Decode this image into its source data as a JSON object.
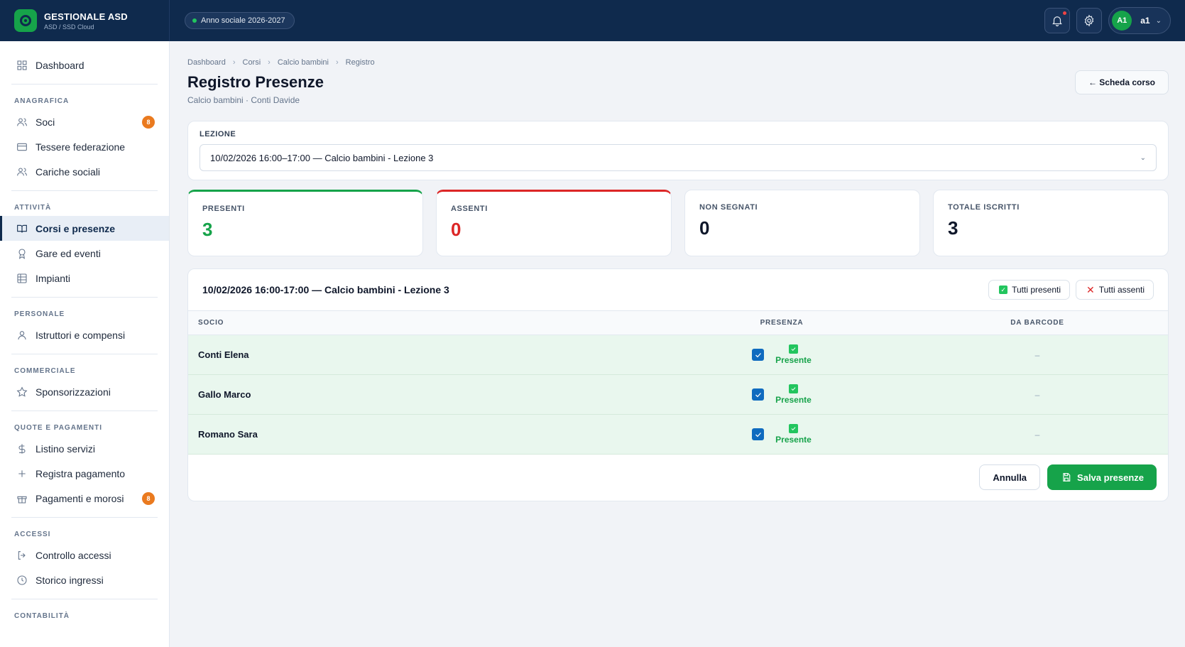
{
  "app": {
    "name": "GESTIONALE ASD",
    "subtitle": "ASD / SSD Cloud",
    "season": "Anno sociale 2026-2027",
    "user_initials": "A1",
    "user_name": "a1"
  },
  "sidebar": {
    "dashboard": "Dashboard",
    "sections": {
      "anagrafica": "ANAGRAFICA",
      "attivita": "ATTIVITÀ",
      "personale": "PERSONALE",
      "commerciale": "COMMERCIALE",
      "quote": "QUOTE E PAGAMENTI",
      "accessi": "ACCESSI",
      "contabilita": "CONTABILITÀ"
    },
    "items": {
      "soci": "Soci",
      "soci_badge": "8",
      "tessere": "Tessere federazione",
      "cariche": "Cariche sociali",
      "corsi": "Corsi e presenze",
      "gare": "Gare ed eventi",
      "impianti": "Impianti",
      "istruttori": "Istruttori e compensi",
      "sponsor": "Sponsorizzazioni",
      "listino": "Listino servizi",
      "registra": "Registra pagamento",
      "pagamenti": "Pagamenti e morosi",
      "pagamenti_badge": "8",
      "controllo": "Controllo accessi",
      "storico": "Storico ingressi"
    }
  },
  "breadcrumb": [
    "Dashboard",
    "Corsi",
    "Calcio bambini",
    "Registro"
  ],
  "page": {
    "title": "Registro Presenze",
    "subtitle": "Calcio bambini · Conti Davide",
    "back_label": "← Scheda corso"
  },
  "lesson": {
    "label": "LEZIONE",
    "selected": "10/02/2026 16:00–17:00 — Calcio bambini - Lezione 3"
  },
  "stats": {
    "presenti_label": "PRESENTI",
    "presenti": "3",
    "assenti_label": "ASSENTI",
    "assenti": "0",
    "non_segnati_label": "NON SEGNATI",
    "non_segnati": "0",
    "totale_label": "TOTALE ISCRITTI",
    "totale": "3"
  },
  "register": {
    "title": "10/02/2026 16:00-17:00 — Calcio bambini - Lezione 3",
    "all_present": "Tutti presenti",
    "all_absent": "Tutti assenti",
    "columns": [
      "SOCIO",
      "PRESENZA",
      "DA BARCODE"
    ],
    "rows": [
      {
        "name": "Conti Elena",
        "status": "Presente",
        "barcode": "–"
      },
      {
        "name": "Gallo Marco",
        "status": "Presente",
        "barcode": "–"
      },
      {
        "name": "Romano Sara",
        "status": "Presente",
        "barcode": "–"
      }
    ],
    "cancel": "Annulla",
    "save": "Salva presenze"
  },
  "colors": {
    "navy": "#0f2a4d",
    "green": "#16a34a",
    "red": "#dc2626",
    "badge": "#ea7a1f"
  }
}
